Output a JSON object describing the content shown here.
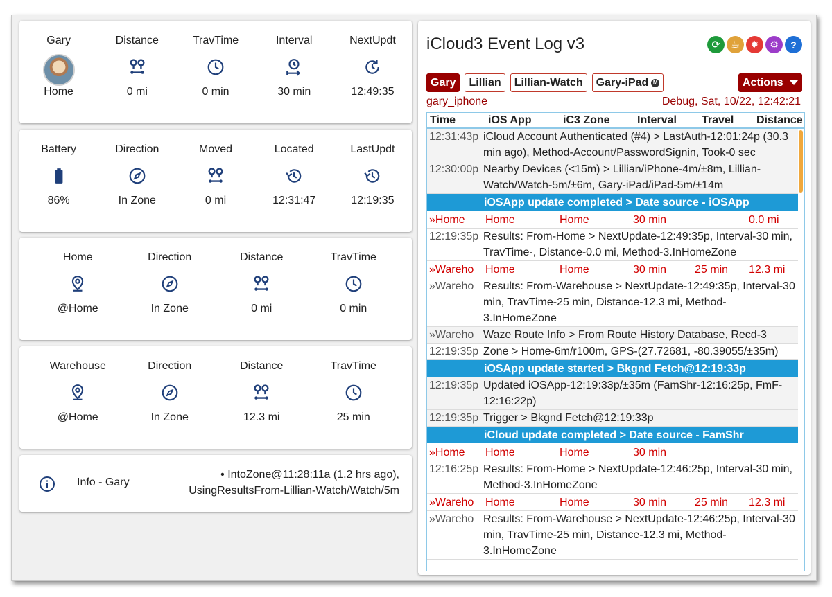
{
  "tracking_cards": [
    {
      "cells": [
        {
          "title": "Gary",
          "icon": "avatar",
          "value": "Home"
        },
        {
          "title": "Distance",
          "icon": "distance-icon",
          "value": "0 mi"
        },
        {
          "title": "TravTime",
          "icon": "clock-icon",
          "value": "0 min"
        },
        {
          "title": "Interval",
          "icon": "timer-interval-icon",
          "value": "30 min"
        },
        {
          "title": "NextUpdt",
          "icon": "refresh-clock-icon",
          "value": "12:49:35"
        }
      ]
    },
    {
      "cells": [
        {
          "title": "Battery",
          "icon": "battery-icon",
          "value": "86%"
        },
        {
          "title": "Direction",
          "icon": "compass-icon",
          "value": "In Zone"
        },
        {
          "title": "Moved",
          "icon": "distance-icon",
          "value": "0 mi"
        },
        {
          "title": "Located",
          "icon": "history-icon",
          "value": "12:31:47"
        },
        {
          "title": "LastUpdt",
          "icon": "history-icon",
          "value": "12:19:35"
        }
      ]
    },
    {
      "cells": [
        {
          "title": "Home",
          "icon": "map-marker-icon",
          "value": "@Home"
        },
        {
          "title": "Direction",
          "icon": "compass-icon",
          "value": "In Zone"
        },
        {
          "title": "Distance",
          "icon": "distance-icon",
          "value": "0 mi"
        },
        {
          "title": "TravTime",
          "icon": "clock-icon",
          "value": "0 min"
        }
      ]
    },
    {
      "cells": [
        {
          "title": "Warehouse",
          "icon": "map-marker-icon",
          "value": "@Home"
        },
        {
          "title": "Direction",
          "icon": "compass-icon",
          "value": "In Zone"
        },
        {
          "title": "Distance",
          "icon": "distance-icon",
          "value": "12.3 mi"
        },
        {
          "title": "TravTime",
          "icon": "clock-icon",
          "value": "25 min"
        }
      ]
    }
  ],
  "info_card": {
    "icon": "info-icon",
    "label": "Info - Gary",
    "text_line1": "• IntoZone@11:28:11a (1.2 hrs ago),",
    "text_line2": "UsingResultsFrom-Lillian-Watch/Watch/5m"
  },
  "event_log": {
    "title": "iCloud3 Event Log v3",
    "header_icons": [
      "refresh-icon",
      "coffee-icon",
      "bug-icon",
      "settings-icon",
      "help-icon"
    ],
    "devices": [
      "Gary",
      "Lillian",
      "Lillian-Watch",
      "Gary-iPad"
    ],
    "actions_label": "Actions",
    "device_name": "gary_iphone",
    "debug_status": "Debug, Sat, 10/22, 12:42:21",
    "columns": [
      "Time",
      "iOS App",
      "iC3 Zone",
      "Interval",
      "Travel",
      "Distance"
    ],
    "rows": [
      {
        "kind": "msg",
        "time": "12:31:43p",
        "text": "iCloud Account Authenticated (#4) > LastAuth-12:01:24p (30.3 min ago), Method-Account/PasswordSignin, Took-0 sec",
        "alt": true
      },
      {
        "kind": "msg",
        "time": "12:30:00p",
        "text": "Nearby Devices (<15m) > Lillian/iPhone-4m/±8m, Lillian-Watch/Watch-5m/±6m, Gary-iPad/iPad-5m/±14m",
        "alt": true
      },
      {
        "kind": "banner",
        "text": "iOSApp update completed > Date source - iOSApp"
      },
      {
        "kind": "track",
        "zone": "»Home",
        "ios": "Home",
        "ic3": "Home",
        "interval": "30 min",
        "travel": "",
        "distance": "0.0 mi"
      },
      {
        "kind": "msg",
        "time": "12:19:35p",
        "text": "Results: From-Home > NextUpdate-12:49:35p, Interval-30 min, TravTime-, Distance-0.0 mi, Method-3.InHomeZone",
        "alt": false
      },
      {
        "kind": "track",
        "zone": "»Wareho",
        "ios": "Home",
        "ic3": "Home",
        "interval": "30 min",
        "travel": "25 min",
        "distance": "12.3 mi"
      },
      {
        "kind": "msg",
        "time": "»Wareho",
        "text": "Results: From-Warehouse > NextUpdate-12:49:35p, Interval-30 min, TravTime-25 min, Distance-12.3 mi, Method-3.InHomeZone",
        "alt": false
      },
      {
        "kind": "msg",
        "time": "»Wareho",
        "text": "Waze Route Info > From Route History Database, Recd-3",
        "alt": true
      },
      {
        "kind": "msg",
        "time": "12:19:35p",
        "text": "Zone > Home-6m/r100m, GPS-(27.72681, -80.39055/±35m)",
        "alt": false
      },
      {
        "kind": "banner",
        "text": "iOSApp update started > Bkgnd Fetch@12:19:33p"
      },
      {
        "kind": "msg",
        "time": "12:19:35p",
        "text": "Updated iOSApp-12:19:33p/±35m (FamShr-12:16:25p, FmF-12:16:22p)",
        "alt": true
      },
      {
        "kind": "msg",
        "time": "12:19:35p",
        "text": "Trigger > Bkgnd Fetch@12:19:33p",
        "alt": true
      },
      {
        "kind": "banner",
        "text": "iCloud update completed > Date source - FamShr"
      },
      {
        "kind": "track",
        "zone": "»Home",
        "ios": "Home",
        "ic3": "Home",
        "interval": "30 min",
        "travel": "",
        "distance": ""
      },
      {
        "kind": "msg",
        "time": "12:16:25p",
        "text": "Results: From-Home > NextUpdate-12:46:25p, Interval-30 min, Method-3.InHomeZone",
        "alt": false
      },
      {
        "kind": "track",
        "zone": "»Wareho",
        "ios": "Home",
        "ic3": "Home",
        "interval": "30 min",
        "travel": "25 min",
        "distance": "12.3 mi"
      },
      {
        "kind": "msg",
        "time": "»Wareho",
        "text": "Results: From-Warehouse > NextUpdate-12:46:25p, Interval-30 min, TravTime-25 min, Distance-12.3 mi, Method-3.InHomeZone",
        "alt": false
      }
    ]
  },
  "colors": {
    "icon_blue": "#1f3f7a",
    "accent_red": "#990000",
    "banner_blue": "#1e9ad6",
    "track_red": "#d10000"
  }
}
